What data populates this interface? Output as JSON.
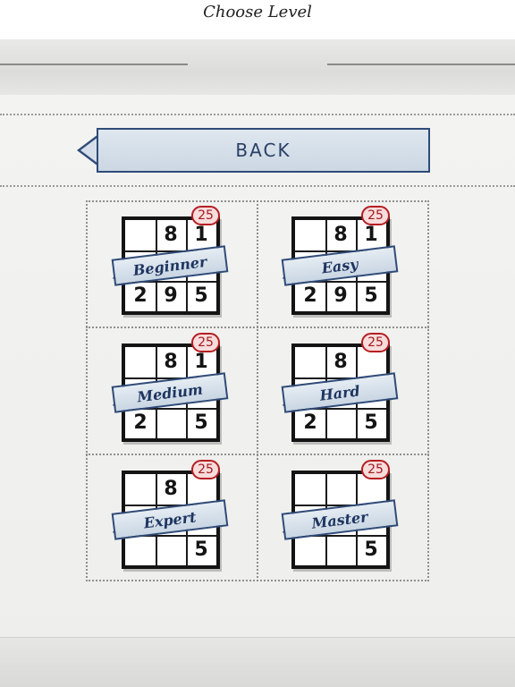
{
  "header": {
    "title": "Choose Level"
  },
  "back_button": {
    "label": "BACK"
  },
  "levels": [
    {
      "name": "Beginner",
      "badge": "25",
      "cells": [
        "",
        "8",
        "1",
        "",
        "",
        "",
        "2",
        "9",
        "5"
      ]
    },
    {
      "name": "Easy",
      "badge": "25",
      "cells": [
        "",
        "8",
        "1",
        "",
        "",
        "",
        "2",
        "9",
        "5"
      ]
    },
    {
      "name": "Medium",
      "badge": "25",
      "cells": [
        "",
        "8",
        "1",
        "",
        "",
        "",
        "2",
        "",
        "5"
      ]
    },
    {
      "name": "Hard",
      "badge": "25",
      "cells": [
        "",
        "8",
        "",
        "",
        "",
        "",
        "2",
        "",
        "5"
      ]
    },
    {
      "name": "Expert",
      "badge": "25",
      "cells": [
        "",
        "8",
        "",
        "",
        "",
        "",
        "",
        "",
        "5"
      ]
    },
    {
      "name": "Master",
      "badge": "25",
      "cells": [
        "",
        "",
        "",
        "",
        "",
        "",
        "",
        "",
        "5"
      ]
    }
  ],
  "colors": {
    "ribbon_border": "#2f4b78",
    "badge_red": "#b51e23",
    "paper": "#f1f1ef"
  }
}
